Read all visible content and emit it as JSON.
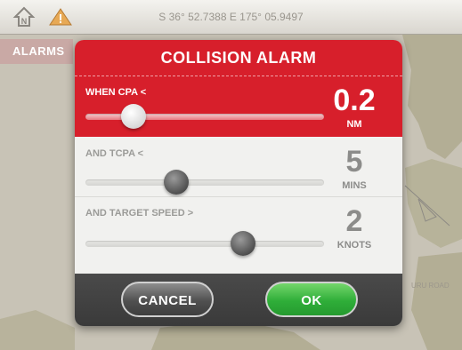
{
  "topbar": {
    "coordinates": "S 36° 52.7388   E 175° 05.9497",
    "home_icon": "home-north-icon",
    "warning_icon": "warning-triangle-icon"
  },
  "sidebar": {
    "alarms_tab": "ALARMS"
  },
  "map": {
    "label": "URU ROAD"
  },
  "dialog": {
    "title": "COLLISION ALARM",
    "accent_color": "#d71f2b",
    "rows": [
      {
        "label": "WHEN CPA <",
        "value": "0.2",
        "unit": "NM",
        "slider_fraction": 0.2
      },
      {
        "label": "AND TCPA <",
        "value": "5",
        "unit": "MINS",
        "slider_fraction": 0.38
      },
      {
        "label": "AND TARGET SPEED >",
        "value": "2",
        "unit": "KNOTS",
        "slider_fraction": 0.66
      }
    ],
    "buttons": {
      "cancel": "CANCEL",
      "ok": "OK"
    }
  }
}
